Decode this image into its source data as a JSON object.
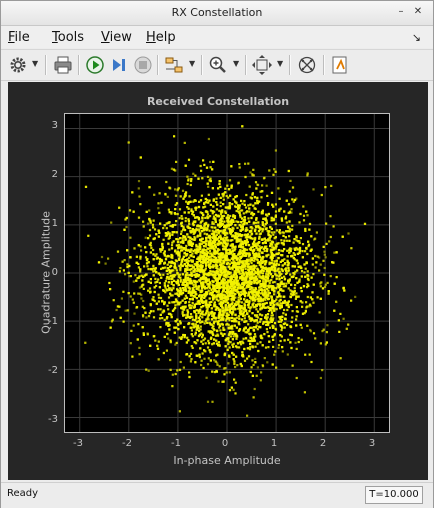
{
  "window": {
    "title": "RX Constellation"
  },
  "menu": [
    {
      "name": "menu-file",
      "label": "File",
      "mnemonic": "F",
      "rest": "ile"
    },
    {
      "name": "menu-tools",
      "label": "Tools",
      "mnemonic": "T",
      "rest": "ools"
    },
    {
      "name": "menu-view",
      "label": "View",
      "mnemonic": "V",
      "rest": "iew"
    },
    {
      "name": "menu-help",
      "label": "Help",
      "mnemonic": "H",
      "rest": "elp"
    }
  ],
  "toolbar": {
    "icons": [
      "gear-icon",
      "print-icon",
      "run-icon",
      "step-forward-icon",
      "stop-icon",
      "signal-routing-icon",
      "zoom-in-icon",
      "fit-to-view-icon",
      "reference-constellation-icon",
      "highlight-icon"
    ]
  },
  "plot": {
    "title": "Received Constellation",
    "xlabel": "In-phase Amplitude",
    "ylabel": "Quadrature Amplitude",
    "xticks": [
      "-3",
      "-2",
      "-1",
      "0",
      "1",
      "2",
      "3"
    ],
    "yticks": [
      "3",
      "2",
      "1",
      "0",
      "-1",
      "-2",
      "-3"
    ]
  },
  "chart_data": {
    "type": "scatter",
    "title": "Received Constellation",
    "xlabel": "In-phase Amplitude",
    "ylabel": "Quadrature Amplitude",
    "xlim": [
      -3.3,
      3.3
    ],
    "ylim": [
      -3.3,
      3.3
    ],
    "grid": true,
    "marker_color": "#f2f200",
    "background": "#000000",
    "distribution": {
      "center": [
        0,
        0
      ],
      "spread_std": 0.85,
      "extent": [
        -3.1,
        3.1
      ]
    }
  },
  "status": {
    "text": "Ready",
    "time": "T=10.000"
  }
}
